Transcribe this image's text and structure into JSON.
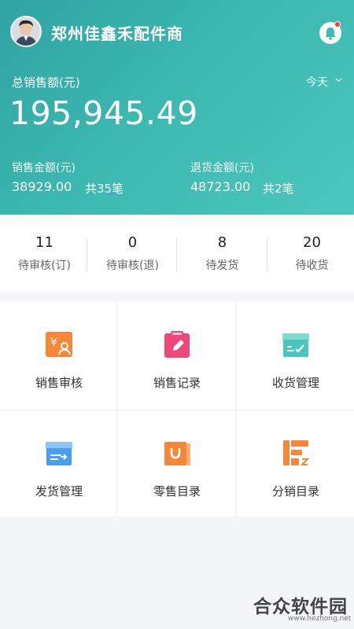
{
  "header": {
    "shop_name": "郑州佳鑫禾配件商",
    "avatar": "user-avatar",
    "notification_icon": "bell-icon"
  },
  "summary": {
    "total_label": "总销售额(元)",
    "period": "今天",
    "total_value": "195,945.49",
    "sales_label": "销售金额(元)",
    "sales_value": "38929.00",
    "sales_count": "共35笔",
    "returns_label": "退货金额(元)",
    "returns_value": "48723.00",
    "returns_count": "共2笔"
  },
  "status": [
    {
      "count": "11",
      "label": "待审核(订)"
    },
    {
      "count": "0",
      "label": "待审核(退)"
    },
    {
      "count": "8",
      "label": "待发货"
    },
    {
      "count": "20",
      "label": "待收货"
    }
  ],
  "menu": [
    {
      "label": "销售审核",
      "icon": "yuan-audit-icon",
      "color": "#f5873a"
    },
    {
      "label": "销售记录",
      "icon": "edit-record-icon",
      "color": "#f0477a"
    },
    {
      "label": "收货管理",
      "icon": "receive-box-icon",
      "color": "#48c6bd"
    },
    {
      "label": "发货管理",
      "icon": "ship-box-icon",
      "color": "#4a9ef0"
    },
    {
      "label": "零售目录",
      "icon": "retail-bag-icon",
      "color": "#f5873a"
    },
    {
      "label": "分销目录",
      "icon": "distribution-catalog-icon",
      "color": "#f5873a"
    }
  ],
  "watermark": {
    "title": "合众软件园",
    "url": "www.hezhong.net"
  },
  "colors": {
    "hero_start": "#2fa3a3",
    "hero_end": "#4cc7bd",
    "badge": "#f0443c"
  }
}
